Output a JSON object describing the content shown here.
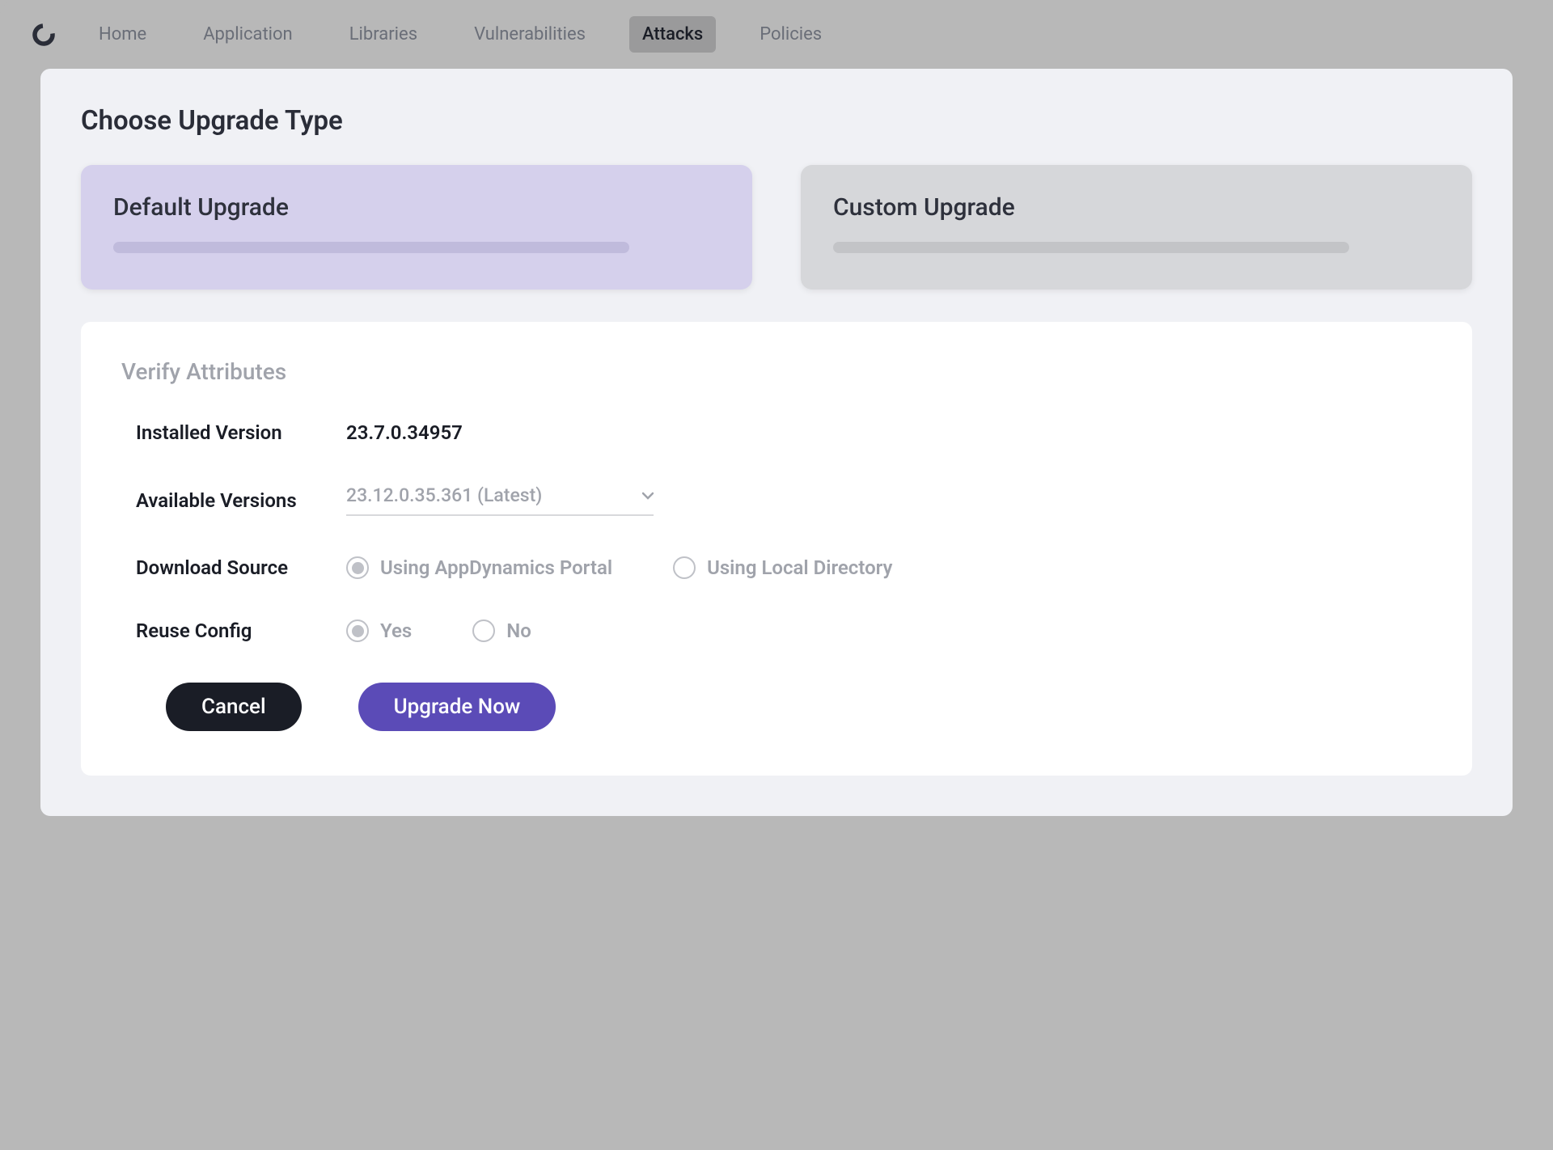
{
  "nav": {
    "items": [
      {
        "label": "Home",
        "active": false
      },
      {
        "label": "Application",
        "active": false
      },
      {
        "label": "Libraries",
        "active": false
      },
      {
        "label": "Vulnerabilities",
        "active": false
      },
      {
        "label": "Attacks",
        "active": true
      },
      {
        "label": "Policies",
        "active": false
      }
    ]
  },
  "modal": {
    "title": "Choose Upgrade Type",
    "cards": {
      "default": "Default Upgrade",
      "custom": "Custom Upgrade"
    },
    "attributes": {
      "title": "Verify Attributes",
      "installed_label": "Installed Version",
      "installed_value": "23.7.0.34957",
      "available_label": "Available Versions",
      "available_value": "23.12.0.35.361 (Latest)",
      "source_label": "Download Source",
      "source_portal": "Using AppDynamics Portal",
      "source_local": "Using Local Directory",
      "reuse_label": "Reuse Config",
      "reuse_yes": "Yes",
      "reuse_no": "No"
    },
    "buttons": {
      "cancel": "Cancel",
      "upgrade": "Upgrade Now"
    }
  }
}
